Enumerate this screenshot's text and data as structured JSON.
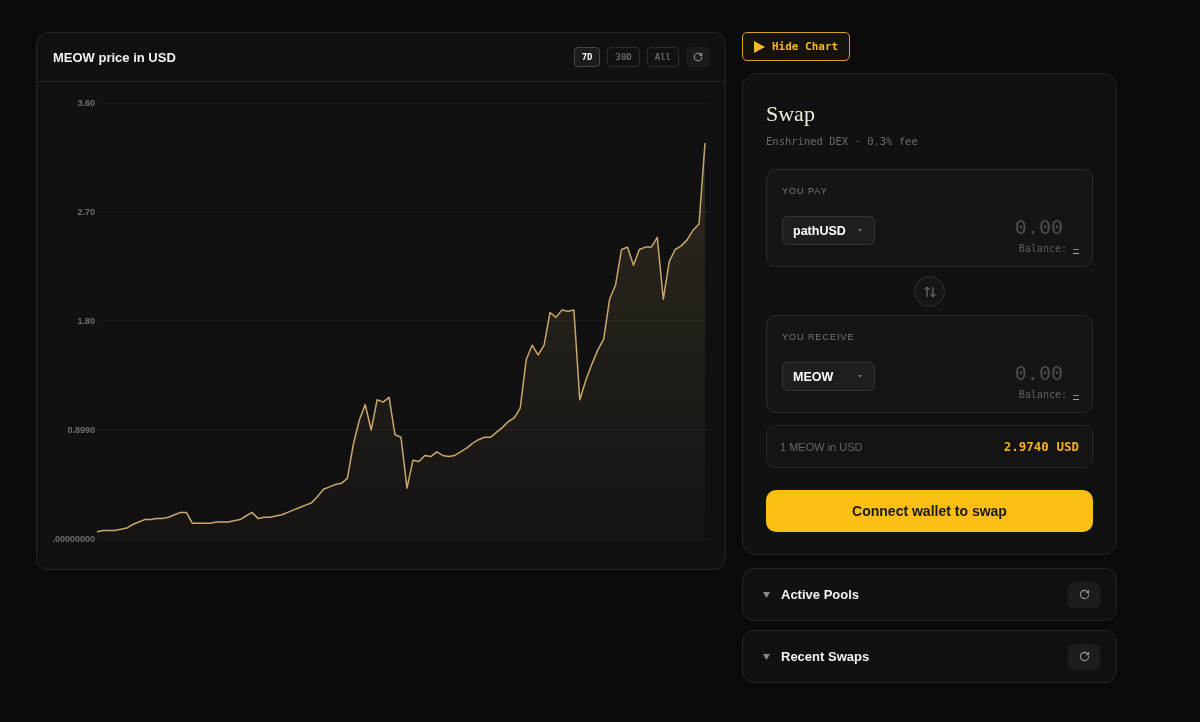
{
  "chart_panel": {
    "title": "MEOW price in USD",
    "ranges": [
      {
        "label": "7D",
        "selected": true
      },
      {
        "label": "30D",
        "selected": false
      },
      {
        "label": "All",
        "selected": false
      }
    ],
    "chart_data": {
      "type": "area",
      "ylim": [
        0,
        3.6
      ],
      "yticks": [
        {
          "value": 0,
          "label": ".00000000"
        },
        {
          "value": 0.899,
          "label": "0.8990"
        },
        {
          "value": 1.8,
          "label": "1.80"
        },
        {
          "value": 2.7,
          "label": "2.70"
        },
        {
          "value": 3.6,
          "label": "3.60"
        }
      ],
      "series": [
        {
          "color": "#c9a66b",
          "values": [
            0.06,
            0.07,
            0.07,
            0.07,
            0.08,
            0.09,
            0.12,
            0.14,
            0.16,
            0.16,
            0.17,
            0.17,
            0.18,
            0.2,
            0.22,
            0.22,
            0.13,
            0.13,
            0.13,
            0.13,
            0.14,
            0.14,
            0.14,
            0.15,
            0.16,
            0.19,
            0.22,
            0.17,
            0.18,
            0.18,
            0.19,
            0.2,
            0.22,
            0.24,
            0.26,
            0.28,
            0.3,
            0.35,
            0.41,
            0.43,
            0.45,
            0.46,
            0.5,
            0.78,
            0.98,
            1.11,
            0.9,
            1.15,
            1.13,
            1.17,
            0.86,
            0.84,
            0.42,
            0.65,
            0.64,
            0.69,
            0.68,
            0.72,
            0.69,
            0.68,
            0.69,
            0.72,
            0.75,
            0.79,
            0.82,
            0.84,
            0.84,
            0.88,
            0.92,
            0.97,
            1.0,
            1.08,
            1.48,
            1.6,
            1.52,
            1.6,
            1.87,
            1.83,
            1.89,
            1.88,
            1.89,
            1.15,
            1.31,
            1.44,
            1.56,
            1.65,
            1.98,
            2.1,
            2.39,
            2.41,
            2.26,
            2.39,
            2.41,
            2.41,
            2.49,
            1.98,
            2.29,
            2.39,
            2.42,
            2.47,
            2.55,
            2.6,
            3.27
          ]
        }
      ]
    }
  },
  "hide_chart_button": {
    "label": "Hide Chart"
  },
  "swap": {
    "title": "Swap",
    "subtitle": "Enshrined DEX · 0.3% fee",
    "legs": [
      {
        "label": "YOU PAY",
        "token": "pathUSD",
        "placeholder": "0.00",
        "balance_label": "Balance:",
        "balance_value": "–"
      },
      {
        "label": "YOU RECEIVE",
        "token": "MEOW",
        "placeholder": "0.00",
        "balance_label": "Balance:",
        "balance_value": "–"
      }
    ],
    "rate": {
      "label": "1 MEOW in USD",
      "value": "2.9740 USD"
    },
    "connect_button": {
      "label": "Connect wallet to swap"
    }
  },
  "sections": [
    {
      "title": "Active Pools"
    },
    {
      "title": "Recent Swaps"
    }
  ]
}
